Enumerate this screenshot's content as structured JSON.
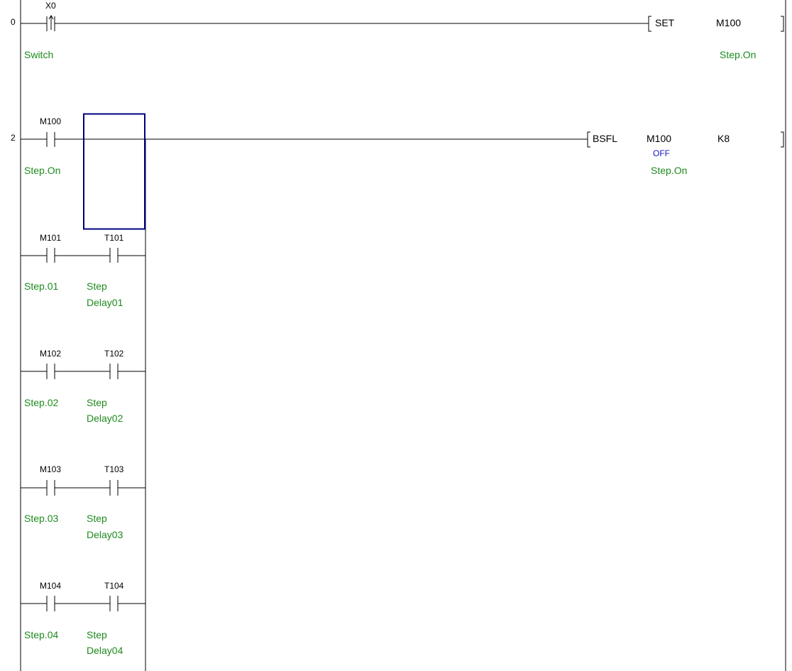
{
  "colors": {
    "rung_line": "#000000",
    "comment": "#1e8a1e",
    "monitor": "#1414c8",
    "cursor": "#000080",
    "background": "#ffffff"
  },
  "rungs": [
    {
      "step": "0",
      "contacts": [
        {
          "device": "X0",
          "type": "rising-edge",
          "comment": "Switch"
        }
      ],
      "instruction": {
        "name": "SET",
        "operands": [
          {
            "value": "M100",
            "comment": "Step.On"
          }
        ]
      }
    },
    {
      "step": "2",
      "contacts": [
        {
          "device": "M100",
          "type": "normally-open",
          "comment": "Step.On"
        }
      ],
      "instruction": {
        "name": "BSFL",
        "operands": [
          {
            "value": "M100",
            "monitor": "OFF",
            "comment": "Step.On"
          },
          {
            "value": "K8"
          }
        ]
      },
      "branches": [
        {
          "contacts": [
            {
              "device": "M101",
              "type": "normally-open",
              "comment": [
                "Step.01"
              ]
            },
            {
              "device": "T101",
              "type": "normally-open",
              "comment": [
                "Step",
                "Delay01"
              ]
            }
          ]
        },
        {
          "contacts": [
            {
              "device": "M102",
              "type": "normally-open",
              "comment": [
                "Step.02"
              ]
            },
            {
              "device": "T102",
              "type": "normally-open",
              "comment": [
                "Step",
                "Delay02"
              ]
            }
          ]
        },
        {
          "contacts": [
            {
              "device": "M103",
              "type": "normally-open",
              "comment": [
                "Step.03"
              ]
            },
            {
              "device": "T103",
              "type": "normally-open",
              "comment": [
                "Step",
                "Delay03"
              ]
            }
          ]
        },
        {
          "contacts": [
            {
              "device": "M104",
              "type": "normally-open",
              "comment": [
                "Step.04"
              ]
            },
            {
              "device": "T104",
              "type": "normally-open",
              "comment": [
                "Step",
                "Delay04"
              ]
            }
          ]
        }
      ]
    }
  ]
}
